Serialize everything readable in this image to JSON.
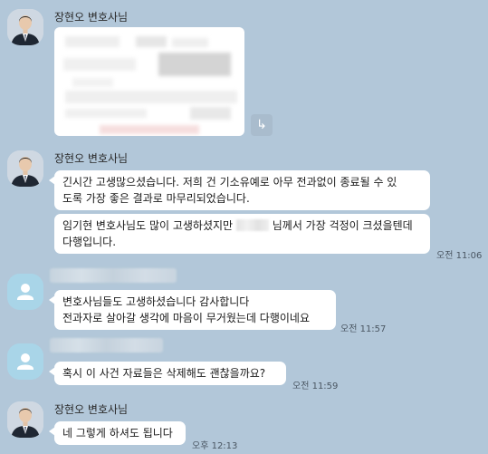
{
  "sender_name": "장현오 변호사님",
  "icons": {
    "share": "share-arrow-icon",
    "avatar_lawyer": "lawyer-profile-photo",
    "avatar_default": "default-user-icon"
  },
  "colors": {
    "background": "#b2c7d9",
    "bubble": "#ffffff",
    "default_avatar": "#a9d5e8"
  },
  "messages": {
    "m1_line1": "긴시간 고생많으셨습니다. 저희 건 기소유예로 아무 전과없이 종료될 수 있",
    "m1_line2": "도록 가장 좋은 결과로 마무리되었습니다.",
    "m2_line1_a": "임기현 변호사님도 많이 고생하셨지만",
    "m2_line1_b": "님께서 가장 걱정이 크셨을텐데",
    "m2_line2": "다행입니다.",
    "m2_time": "오전 11:06",
    "m3_line1": "변호사님들도 고생하셨습니다 감사합니다",
    "m3_line2": "전과자로 살아갈 생각에 마음이 무거웠는데 다행이네요",
    "m3_time": "오전 11:57",
    "m4_text": "혹시 이 사건 자료들은 삭제해도 괜찮을까요?",
    "m4_time": "오전 11:59",
    "m5_text": "네 그렇게 하셔도 됩니다",
    "m5_time": "오후 12:13"
  }
}
